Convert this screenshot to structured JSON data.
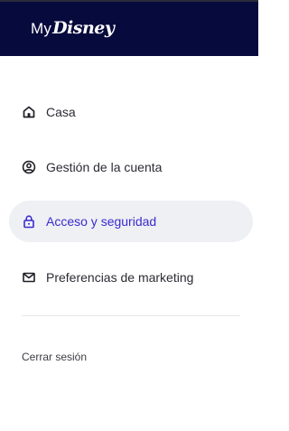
{
  "header": {
    "logo_prefix": "My",
    "logo_brand": "Disney",
    "background_color": "#070a3c"
  },
  "nav": {
    "items": [
      {
        "label": "Casa",
        "icon": "home-icon",
        "active": false
      },
      {
        "label": "Gestión de la cuenta",
        "icon": "account-circle-icon",
        "active": false
      },
      {
        "label": "Acceso y seguridad",
        "icon": "lock-icon",
        "active": true
      },
      {
        "label": "Preferencias de marketing",
        "icon": "mail-icon",
        "active": false
      }
    ],
    "active_color": "#3a2bd0",
    "active_background": "#eef0f3"
  },
  "footer": {
    "logout_label": "Cerrar sesión"
  }
}
